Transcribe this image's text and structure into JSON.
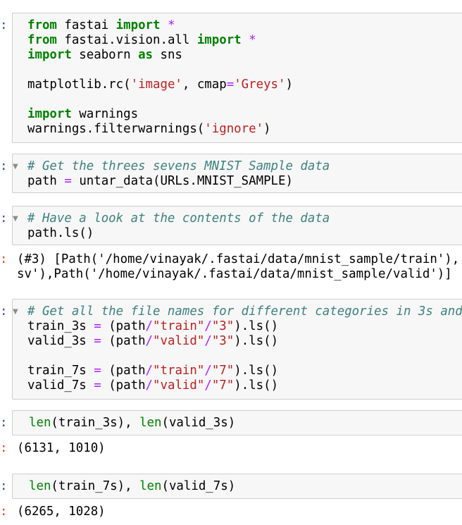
{
  "cells": [
    {
      "prompt": ":",
      "lines": [
        [
          {
            "t": "from",
            "c": "kw"
          },
          {
            "t": " fastai "
          },
          {
            "t": "import",
            "c": "kw"
          },
          {
            "t": " "
          },
          {
            "t": "*",
            "c": "op"
          }
        ],
        [
          {
            "t": "from",
            "c": "kw"
          },
          {
            "t": " fastai.vision.all "
          },
          {
            "t": "import",
            "c": "kw"
          },
          {
            "t": " "
          },
          {
            "t": "*",
            "c": "op"
          }
        ],
        [
          {
            "t": "import",
            "c": "kw"
          },
          {
            "t": " seaborn "
          },
          {
            "t": "as",
            "c": "kw"
          },
          {
            "t": " sns"
          }
        ],
        [],
        [
          {
            "t": "matplotlib.rc("
          },
          {
            "t": "'image'",
            "c": "str"
          },
          {
            "t": ", cmap"
          },
          {
            "t": "=",
            "c": "op"
          },
          {
            "t": "'Greys'",
            "c": "str"
          },
          {
            "t": ")"
          }
        ],
        [],
        [
          {
            "t": "import",
            "c": "kw"
          },
          {
            "t": " warnings"
          }
        ],
        [
          {
            "t": "warnings.filterwarnings("
          },
          {
            "t": "'ignore'",
            "c": "str"
          },
          {
            "t": ")"
          }
        ]
      ]
    },
    {
      "prompt": ":",
      "collapse_icon": "triangle-down-icon",
      "lines": [
        [
          {
            "t": "# Get the threes sevens MNIST Sample data",
            "c": "cm"
          }
        ],
        [
          {
            "t": "path "
          },
          {
            "t": "=",
            "c": "op"
          },
          {
            "t": " untar_data(URLs.MNIST_SAMPLE)"
          }
        ]
      ]
    },
    {
      "prompt": ":",
      "collapse_icon": "triangle-down-icon",
      "lines": [
        [
          {
            "t": "# Have a look at the contents of the data",
            "c": "cm"
          }
        ],
        [
          {
            "t": "path.ls()"
          }
        ]
      ]
    },
    {
      "prompt": ":",
      "collapse_icon": "triangle-down-icon",
      "lines": [
        [
          {
            "t": "# Get all the file names for different categories in 3s and",
            "c": "cm"
          }
        ],
        [
          {
            "t": "train_3s "
          },
          {
            "t": "=",
            "c": "op"
          },
          {
            "t": " (path"
          },
          {
            "t": "/",
            "c": "op"
          },
          {
            "t": "\"train\"",
            "c": "str"
          },
          {
            "t": "/",
            "c": "op"
          },
          {
            "t": "\"3\"",
            "c": "str"
          },
          {
            "t": ").ls()"
          }
        ],
        [
          {
            "t": "valid_3s "
          },
          {
            "t": "=",
            "c": "op"
          },
          {
            "t": " (path"
          },
          {
            "t": "/",
            "c": "op"
          },
          {
            "t": "\"valid\"",
            "c": "str"
          },
          {
            "t": "/",
            "c": "op"
          },
          {
            "t": "\"3\"",
            "c": "str"
          },
          {
            "t": ").ls()"
          }
        ],
        [],
        [
          {
            "t": "train_7s "
          },
          {
            "t": "=",
            "c": "op"
          },
          {
            "t": " (path"
          },
          {
            "t": "/",
            "c": "op"
          },
          {
            "t": "\"train\"",
            "c": "str"
          },
          {
            "t": "/",
            "c": "op"
          },
          {
            "t": "\"7\"",
            "c": "str"
          },
          {
            "t": ").ls()"
          }
        ],
        [
          {
            "t": "valid_7s "
          },
          {
            "t": "=",
            "c": "op"
          },
          {
            "t": " (path"
          },
          {
            "t": "/",
            "c": "op"
          },
          {
            "t": "\"valid\"",
            "c": "str"
          },
          {
            "t": "/",
            "c": "op"
          },
          {
            "t": "\"7\"",
            "c": "str"
          },
          {
            "t": ").ls()"
          }
        ]
      ]
    },
    {
      "prompt": ":",
      "lines": [
        [
          {
            "t": "len",
            "c": "bi"
          },
          {
            "t": "(train_3s), "
          },
          {
            "t": "len",
            "c": "bi"
          },
          {
            "t": "(valid_3s)"
          }
        ]
      ]
    },
    {
      "prompt": ":",
      "lines": [
        [
          {
            "t": "len",
            "c": "bi"
          },
          {
            "t": "(train_7s), "
          },
          {
            "t": "len",
            "c": "bi"
          },
          {
            "t": "(valid_7s)"
          }
        ]
      ]
    }
  ],
  "outputs": [
    {
      "prompt": ":",
      "lines": [
        "(#3) [Path('/home/vinayak/.fastai/data/mnist_sample/train'),",
        "sv'),Path('/home/vinayak/.fastai/data/mnist_sample/valid')]"
      ]
    },
    {
      "prompt": ":",
      "lines": [
        "(6131, 1010)"
      ]
    },
    {
      "prompt": ":",
      "lines": [
        "(6265, 1028)"
      ]
    }
  ]
}
